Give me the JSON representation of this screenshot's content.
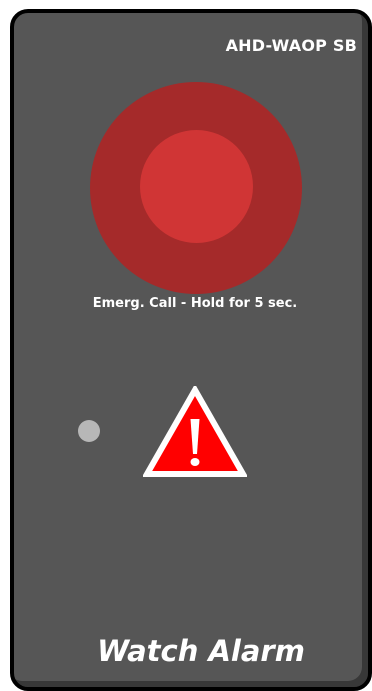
{
  "device": {
    "id": "AHD-WAOP SB",
    "emergency_call_label": "Emerg. Call - Hold for 5 sec.",
    "title": "Watch Alarm"
  },
  "icons": {
    "emergency_button": "emergency-call-button",
    "status_led": "status-led-indicator",
    "warning": "warning-triangle-icon"
  },
  "colors": {
    "panel": "#565656",
    "border": "#000000",
    "button_outer": "#a52a2a",
    "button_inner": "#d03535",
    "warning_red": "#ff0000",
    "led_off": "#b7b7b7",
    "text": "#ffffff"
  }
}
